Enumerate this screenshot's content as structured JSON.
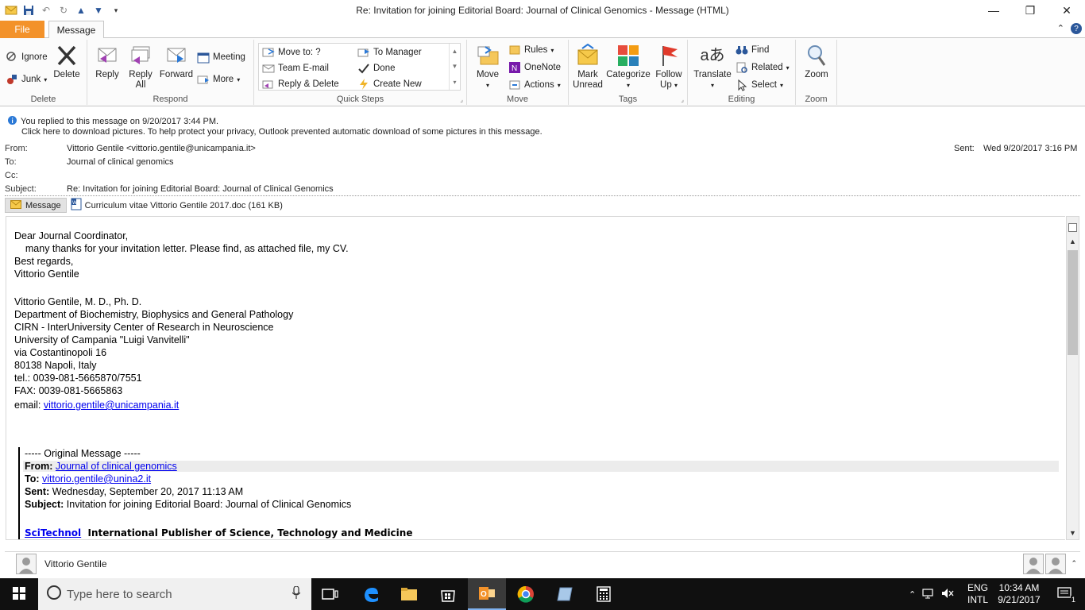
{
  "window": {
    "title": "Re: Invitation for joining Editorial Board: Journal of Clinical Genomics  -  Message (HTML)"
  },
  "tabs": {
    "file": "File",
    "message": "Message"
  },
  "ribbon": {
    "delete_group": {
      "label": "Delete",
      "ignore": "Ignore",
      "junk": "Junk",
      "delete": "Delete"
    },
    "respond_group": {
      "label": "Respond",
      "reply": "Reply",
      "reply_all_1": "Reply",
      "reply_all_2": "All",
      "forward": "Forward",
      "meeting": "Meeting",
      "more": "More"
    },
    "quicksteps_group": {
      "label": "Quick Steps",
      "items": [
        "Move to: ?",
        "To Manager",
        "Team E-mail",
        "Done",
        "Reply & Delete",
        "Create New"
      ]
    },
    "move_group": {
      "label": "Move",
      "move": "Move",
      "rules": "Rules",
      "onenote": "OneNote",
      "actions": "Actions"
    },
    "tags_group": {
      "label": "Tags",
      "mark_unread_1": "Mark",
      "mark_unread_2": "Unread",
      "categorize": "Categorize",
      "follow_up_1": "Follow",
      "follow_up_2": "Up"
    },
    "editing_group": {
      "label": "Editing",
      "translate": "Translate",
      "find": "Find",
      "related": "Related",
      "select": "Select"
    },
    "zoom_group": {
      "label": "Zoom",
      "zoom": "Zoom"
    }
  },
  "info": {
    "replied": "You replied to this message on 9/20/2017 3:44 PM.",
    "pictures": "Click here to download pictures. To help protect your privacy, Outlook prevented automatic download of some pictures in this message."
  },
  "header": {
    "from_label": "From:",
    "from_value": "Vittorio Gentile <vittorio.gentile@unicampania.it>",
    "to_label": "To:",
    "to_value": "Journal of clinical genomics",
    "cc_label": "Cc:",
    "subject_label": "Subject:",
    "subject_value": "Re: Invitation for joining Editorial Board: Journal of Clinical Genomics",
    "sent_label": "Sent:",
    "sent_value": "Wed 9/20/2017 3:16 PM"
  },
  "attachments": {
    "message_tab": "Message",
    "file": "Curriculum vitae Vittorio Gentile 2017.doc (161 KB)"
  },
  "body": {
    "lines": [
      "Dear Journal Coordinator,",
      "    many thanks for your invitation letter. Please find, as attached file, my CV.",
      "Best regards,",
      "Vittorio Gentile",
      "Vittorio Gentile, M. D., Ph. D.",
      "Department of Biochemistry, Biophysics and General Pathology",
      "CIRN - InterUniversity Center of Research in Neuroscience",
      "University of Campania \"Luigi Vanvitelli\"",
      "via Costantinopoli 16",
      "80138 Napoli, Italy",
      "tel.: 0039-081-5665870/7551",
      "FAX: 0039-081-5665863"
    ],
    "email_label": "email:",
    "email_link": "vittorio.gentile@unicampania.it",
    "original_header": "----- Original Message -----",
    "orig_from_label": "From:",
    "orig_from_link": "Journal of clinical genomics",
    "orig_to_label": "To:",
    "orig_to_link": "vittorio.gentile@unina2.it",
    "orig_sent_label": "Sent:",
    "orig_sent_value": "Wednesday, September 20, 2017 11:13 AM",
    "orig_subject_label": "Subject:",
    "orig_subject_value": "Invitation for joining Editorial Board: Journal of Clinical Genomics",
    "publisher_link": "SciTechnol",
    "publisher_text": "International Publisher of Science, Technology and Medicine"
  },
  "people_pane": {
    "name": "Vittorio Gentile"
  },
  "taskbar": {
    "search_placeholder": "Type here to search",
    "lang_1": "ENG",
    "lang_2": "INTL",
    "time": "10:34 AM",
    "date": "9/21/2017",
    "notif_count": "1"
  },
  "colors": {
    "file_tab": "#f3922a",
    "link": "#0000ee",
    "taskbar": "#101010"
  }
}
